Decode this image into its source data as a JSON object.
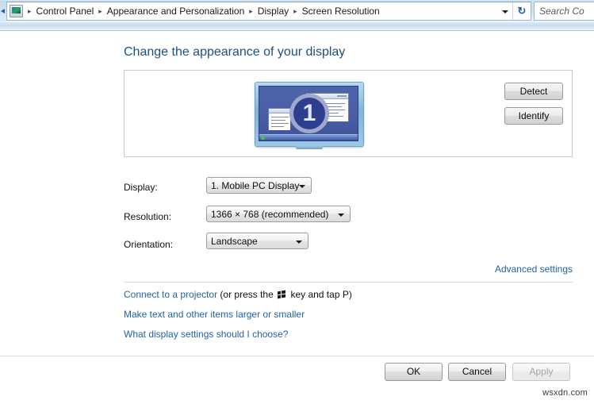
{
  "window": {
    "chrome": {
      "address_icon": "display-settings-icon",
      "breadcrumbs": [
        {
          "label": "Control Panel"
        },
        {
          "label": "Appearance and Personalization"
        },
        {
          "label": "Display"
        },
        {
          "label": "Screen Resolution"
        }
      ],
      "separator": "▸",
      "dropdown_icon": "chevron-down-icon",
      "refresh_icon": "refresh-icon",
      "refresh_glyph": "↻",
      "search": {
        "placeholder": "Search Co",
        "icon": "search-icon"
      }
    }
  },
  "page": {
    "title": "Change the appearance of your display"
  },
  "preview": {
    "monitor_number": "1",
    "buttons": {
      "detect": "Detect",
      "identify": "Identify"
    }
  },
  "form": {
    "display": {
      "label": "Display:",
      "value": "1. Mobile PC Display"
    },
    "resolution": {
      "label": "Resolution:",
      "value": "1366 × 768 (recommended)"
    },
    "orientation": {
      "label": "Orientation:",
      "value": "Landscape"
    },
    "advanced_settings": "Advanced settings"
  },
  "links": {
    "projector": {
      "link": "Connect to a projector",
      "prefix": " (or press the ",
      "icon": "windows-logo-icon",
      "suffix": " key and tap P)"
    },
    "text_size": "Make text and other items larger or smaller",
    "what_settings": "What display settings should I choose?"
  },
  "dialog_buttons": {
    "ok": "OK",
    "cancel": "Cancel",
    "apply": "Apply",
    "apply_enabled": false
  },
  "watermark": "wsxdn.com",
  "colors": {
    "heading": "#1c4f82",
    "link": "#1f63a8",
    "chrome_top": "#d3e3f2",
    "monitor_screen": "#4a5fa6",
    "badge": "#2e3f90"
  }
}
